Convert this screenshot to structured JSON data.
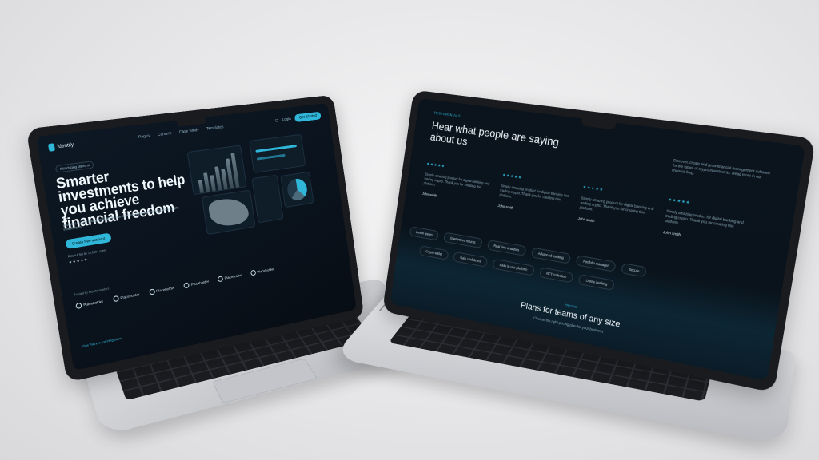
{
  "left_screen": {
    "brand": "Identify",
    "nav": [
      "Pages",
      "Careers",
      "Case Study",
      "Templates"
    ],
    "nav_right": {
      "login": "Login",
      "cta": "Get Started"
    },
    "tag": "Introducing platform",
    "hero_title": "Smarter investments to help you achieve financial freedom",
    "hero_sub": "Discover, create and grow financial management software for the future of crypto investments.",
    "hero_cta": "Create free account",
    "rating_note": "Rated 4.9/5 by 10,000+ users",
    "rating_stars": "★★★★★",
    "partners_title": "Trusted by industry leaders",
    "partners": [
      "Placeholder",
      "Placeholder",
      "Placeholder",
      "Placeholder",
      "Placeholder",
      "Placeholder"
    ],
    "trusted_link": "View Partners and Integrations"
  },
  "right_screen": {
    "tag": "TESTIMONIALS",
    "title": "Hear what people are saying about us",
    "description": "Discover, create and grow financial management software for the future of crypto investments. Read more in our financial blog.",
    "reviews": [
      {
        "stars": "★★★★★",
        "text": "Simply amazing product for digital banking and trading crypto. Thank you for creating this platform.",
        "author": "John smith"
      },
      {
        "stars": "★★★★★",
        "text": "Simply amazing product for digital banking and trading crypto. Thank you for creating this platform.",
        "author": "John smith"
      },
      {
        "stars": "★★★★★",
        "text": "Simply amazing product for digital banking and trading crypto. Thank you for creating this platform.",
        "author": "John smith"
      },
      {
        "stars": "★★★★★",
        "text": "Simply amazing product for digital banking and trading crypto. Thank you for creating this platform.",
        "author": "John smith"
      }
    ],
    "pills_row1": [
      "Lorem ipsum",
      "Guaranteed returns",
      "Real time analytics",
      "Advanced tracking",
      "Portfolio manager",
      "Secure"
    ],
    "pills_row2": [
      "Crypto wallet",
      "Gain confidence",
      "Easy to use platform",
      "NFT collection",
      "Online banking"
    ],
    "plans_tag": "PRICING",
    "plans_title": "Plans for teams of any size",
    "plans_sub": "Choose the right pricing plan for your business"
  }
}
